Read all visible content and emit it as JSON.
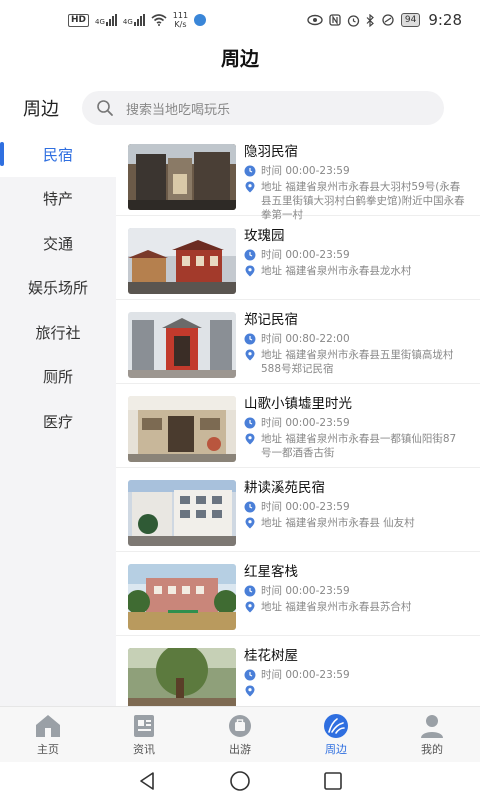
{
  "status_bar": {
    "hd": "HD",
    "net1": "4G",
    "net2": "4G",
    "speed_value": "111",
    "speed_unit": "K/s",
    "battery": "94",
    "time": "9:28",
    "icons": [
      "hd-icon",
      "signal-icon",
      "signal-icon",
      "wifi-icon",
      "app-dot-icon",
      "eye-icon",
      "nfc-icon",
      "alarm-icon",
      "bluetooth-icon",
      "link-icon",
      "battery-icon"
    ]
  },
  "header": {
    "title": "周边"
  },
  "search": {
    "label": "周边",
    "placeholder": "搜索当地吃喝玩乐"
  },
  "sidebar": {
    "items": [
      {
        "label": "民宿",
        "active": true
      },
      {
        "label": "特产",
        "active": false
      },
      {
        "label": "交通",
        "active": false
      },
      {
        "label": "娱乐场所",
        "active": false
      },
      {
        "label": "旅行社",
        "active": false
      },
      {
        "label": "厕所",
        "active": false
      },
      {
        "label": "医疗",
        "active": false
      }
    ]
  },
  "places": [
    {
      "name": "隐羽民宿",
      "time": "时间 00:00-23:59",
      "address": "地址 福建省泉州市永春县大羽村59号(永春县五里街镇大羽村白鹤拳史馆)附近中国永春拳第一村"
    },
    {
      "name": "玫瑰园",
      "time": "时间 00:00-23:59",
      "address": "地址 福建省泉州市永春县龙水村"
    },
    {
      "name": "郑记民宿",
      "time": "时间 00:80-22:00",
      "address": "地址 福建省泉州市永春县五里街镇高垅村588号郑记民宿"
    },
    {
      "name": "山歌小镇墟里时光",
      "time": "时间 00:00-23:59",
      "address": "地址 福建省泉州市永春县一都镇仙阳街87号一都酒香古街"
    },
    {
      "name": "耕读溪苑民宿",
      "time": "时间 00:00-23:59",
      "address": "地址 福建省泉州市永春县 仙友村"
    },
    {
      "name": "红星客栈",
      "time": "时间 00:00-23:59",
      "address": "地址 福建省泉州市永春县苏合村"
    },
    {
      "name": "桂花树屋",
      "time": "时间 00:00-23:59",
      "address": ""
    }
  ],
  "bottom_nav": {
    "items": [
      {
        "label": "主页",
        "icon": "home-icon",
        "active": false
      },
      {
        "label": "资讯",
        "icon": "news-icon",
        "active": false
      },
      {
        "label": "出游",
        "icon": "travel-icon",
        "active": false
      },
      {
        "label": "周边",
        "icon": "nearby-icon",
        "active": true
      },
      {
        "label": "我的",
        "icon": "profile-icon",
        "active": false
      }
    ]
  },
  "colors": {
    "accent": "#2f6fe0",
    "sidebar_bg": "#f4f4f6",
    "search_bg": "#f2f2f4",
    "muted": "#888888"
  }
}
